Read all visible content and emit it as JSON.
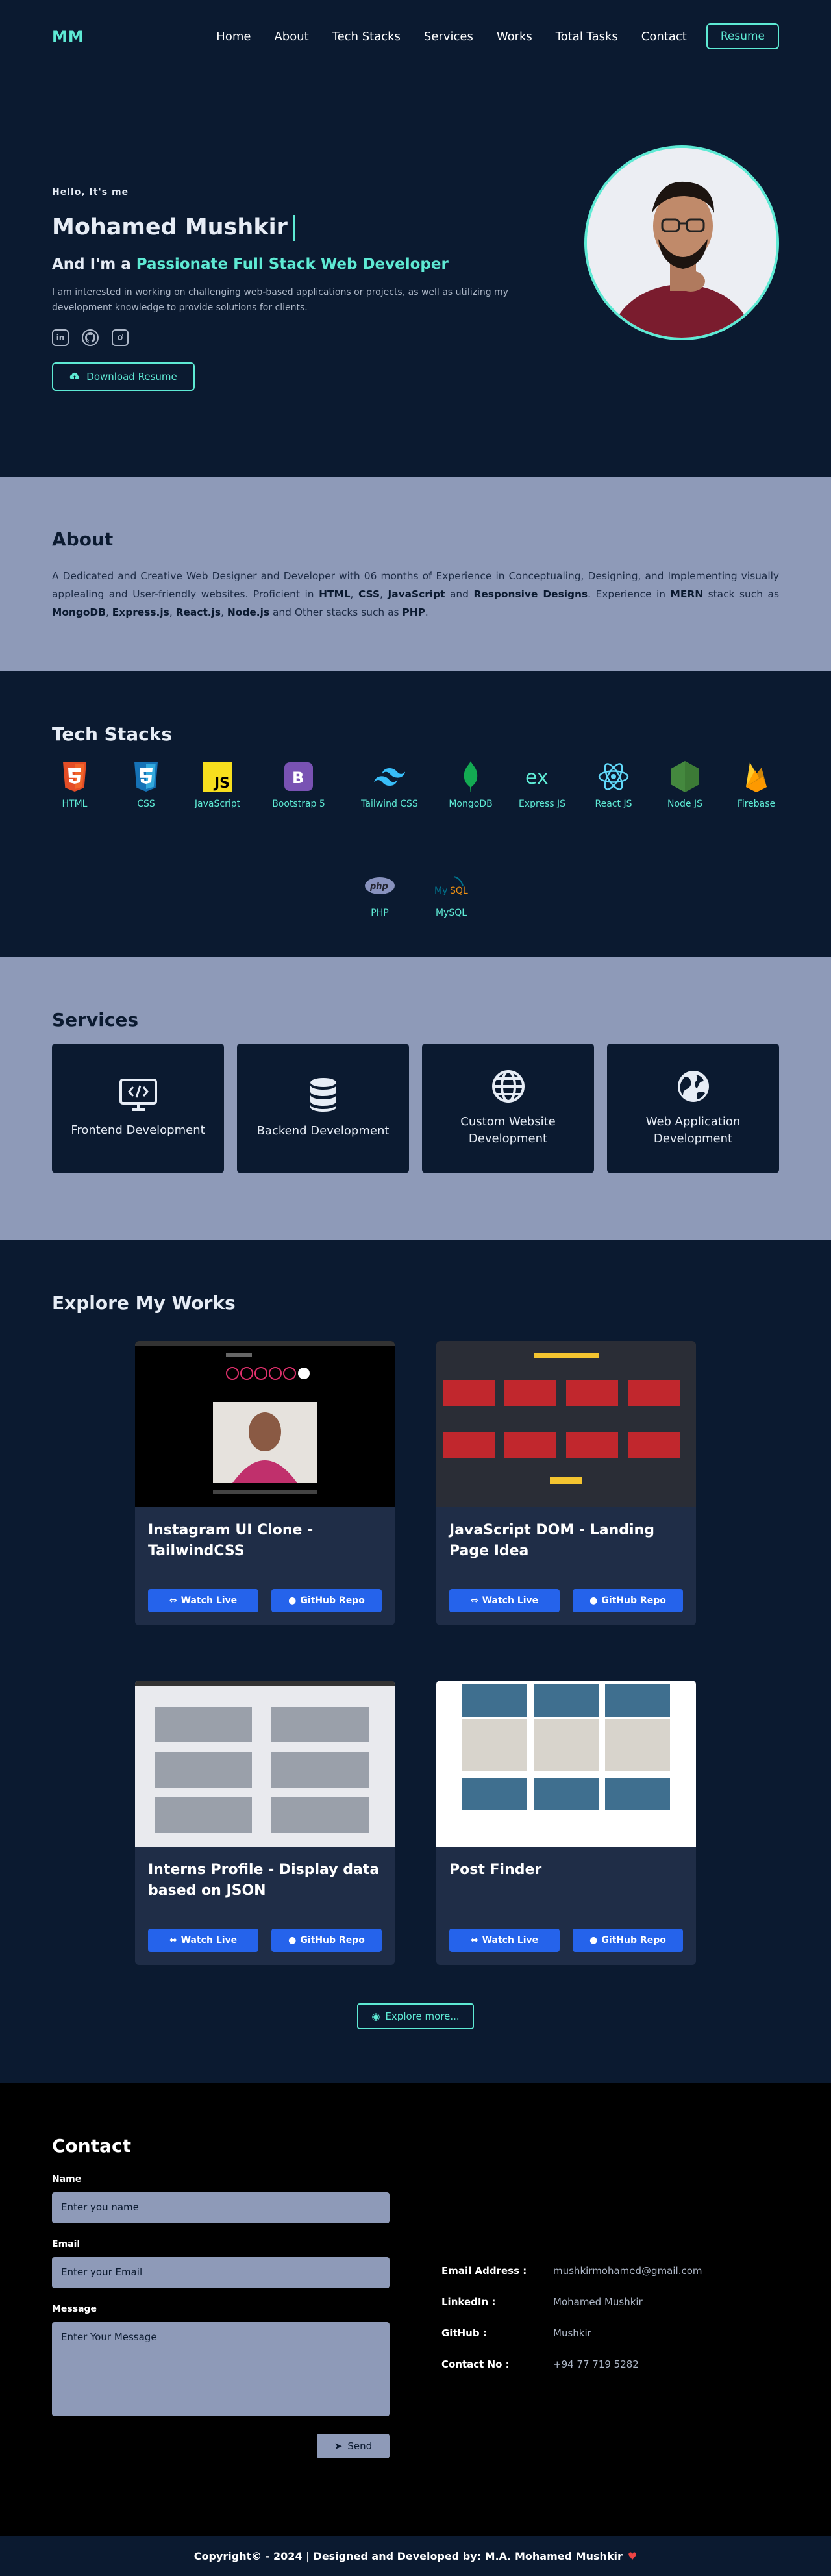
{
  "nav": {
    "logo": "MM",
    "links": [
      "Home",
      "About",
      "Tech Stacks",
      "Services",
      "Works",
      "Total Tasks",
      "Contact"
    ],
    "resume": "Resume"
  },
  "hero": {
    "greeting": "Hello, It's me",
    "name": "Mohamed Mushkir",
    "role_prefix": "And I'm a",
    "role": "Passionate Full Stack Web Developer",
    "intro": "I am interested in working on challenging web-based applications or projects, as well as utilizing my development knowledge to provide solutions for clients.",
    "socials": [
      "linkedin-icon",
      "github-icon",
      "instagram-icon"
    ],
    "download": "Download Resume"
  },
  "about": {
    "title": "About",
    "p1": "A Dedicated and Creative Web Designer and Developer with 06 months of Experience in Conceptualing, Designing, and Implementing visually applealing and User-friendly websites. Proficient in ",
    "html": "HTML",
    "c1": ", ",
    "css": "CSS",
    "c2": ", ",
    "js": "JavaScript",
    "c3": " and ",
    "resp": "Responsive Designs",
    "p2": ". Experience in ",
    "mern": "MERN",
    "p3": " stack such as ",
    "mongo": "MongoDB",
    "c4": ", ",
    "express": "Express.js",
    "c5": ", ",
    "react": "React.js",
    "c6": ", ",
    "node": "Node.js",
    "p4": " and Other stacks such as ",
    "php": "PHP",
    "p5": "."
  },
  "tech": {
    "title": "Tech Stacks",
    "row1": [
      "HTML",
      "CSS",
      "JavaScript",
      "Bootstrap 5",
      "Tailwind CSS",
      "MongoDB",
      "Express JS",
      "React JS",
      "Node JS",
      "Firebase"
    ],
    "row2": [
      "PHP",
      "MySQL"
    ]
  },
  "services": {
    "title": "Services",
    "items": [
      "Frontend Development",
      "Backend Development",
      "Custom Website Development",
      "Web Application Development"
    ]
  },
  "works": {
    "title": "Explore My Works",
    "items": [
      {
        "title": "Instagram UI Clone - TailwindCSS"
      },
      {
        "title": "JavaScript DOM - Landing Page Idea"
      },
      {
        "title": "Interns Profile - Display data based on JSON"
      },
      {
        "title": "Post Finder"
      }
    ],
    "watch": "Watch Live",
    "repo": "GitHub Repo",
    "explore": "Explore more..."
  },
  "contact": {
    "title": "Contact",
    "name_label": "Name",
    "name_ph": "Enter you name",
    "email_label": "Email",
    "email_ph": "Enter your Email",
    "msg_label": "Message",
    "msg_ph": "Enter Your Message",
    "send": "Send",
    "info": [
      {
        "key": "Email Address :",
        "val": "mushkirmohamed@gmail.com"
      },
      {
        "key": "LinkedIn :",
        "val": "Mohamed Mushkir"
      },
      {
        "key": "GitHub :",
        "val": "Mushkir"
      },
      {
        "key": "Contact No :",
        "val": "+94 77 719 5282"
      }
    ]
  },
  "footer": {
    "text": "Copyright© - 2024 | Designed and Developed by: M.A. Mohamed Mushkir"
  },
  "colors": {
    "accent": "#5eead4",
    "bg": "#0b1a30",
    "section": "#8e9ab8",
    "button": "#2563eb"
  }
}
